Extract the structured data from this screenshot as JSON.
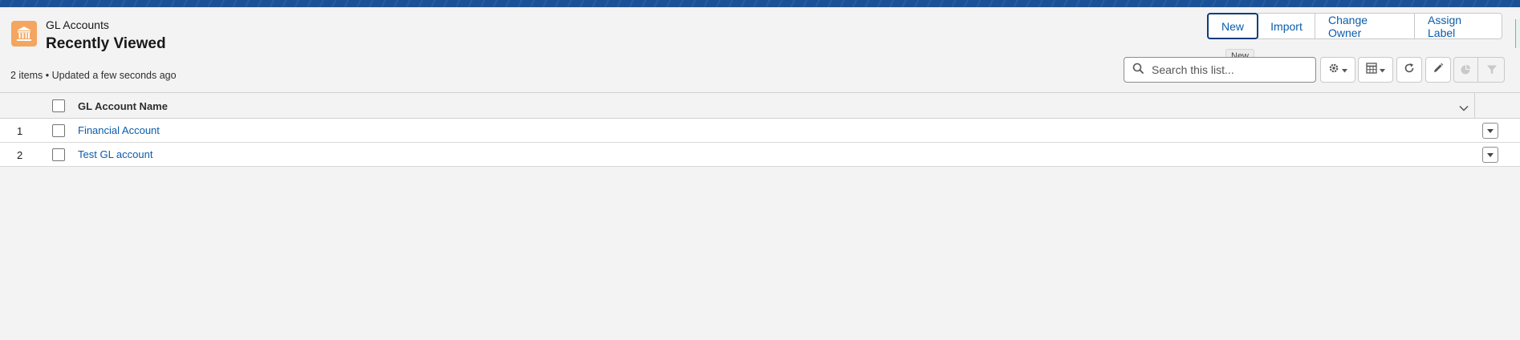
{
  "header": {
    "object_label": "GL Accounts",
    "list_title": "Recently Viewed",
    "meta": "2 items • Updated a few seconds ago"
  },
  "actions": {
    "new_label": "New",
    "import_label": "Import",
    "change_owner_label": "Change Owner",
    "assign_label_label": "Assign Label",
    "tooltip": "New"
  },
  "search": {
    "placeholder": "Search this list..."
  },
  "toolbar": {
    "icons": [
      "gear-icon",
      "table-icon",
      "refresh-icon",
      "pencil-icon",
      "chart-icon",
      "filter-icon"
    ]
  },
  "table": {
    "columns": [
      "GL Account Name"
    ],
    "rows": [
      {
        "num": "1",
        "name": "Financial Account"
      },
      {
        "num": "2",
        "name": "Test GL account"
      }
    ]
  },
  "colors": {
    "brand_band": "#1b5297",
    "object_icon": "#f4a55f",
    "link": "#0b5cab"
  }
}
